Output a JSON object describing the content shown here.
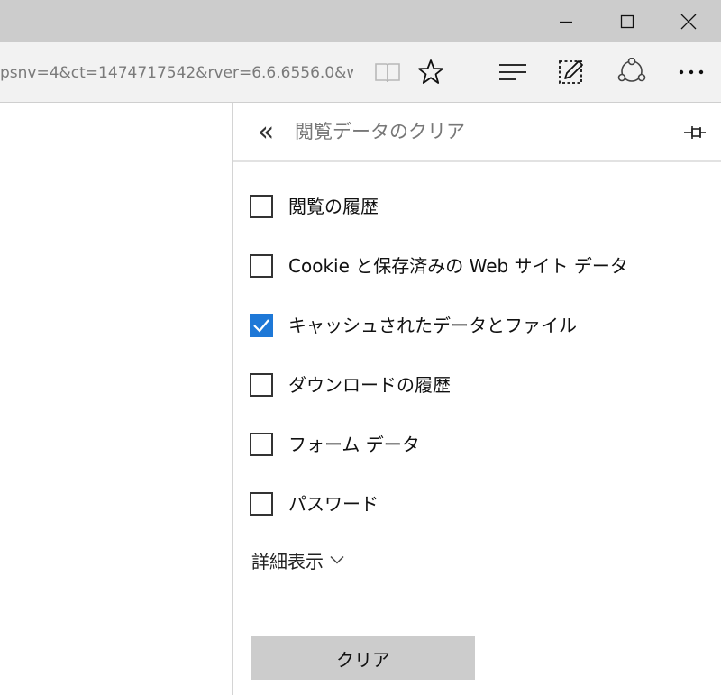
{
  "address_bar": {
    "url_text": "psnv=4&ct=1474717542&rver=6.6.6556.0&w"
  },
  "toolbar": {
    "icons": [
      "reading-view-icon",
      "favorite-star-icon",
      "hub-icon",
      "web-note-icon",
      "share-icon",
      "more-icon"
    ]
  },
  "window_controls": {
    "icons": [
      "minimize-icon",
      "maximize-icon",
      "close-icon"
    ]
  },
  "clear_panel": {
    "title": "閲覧データのクリア",
    "back_glyph": "«",
    "options": [
      {
        "label": "閲覧の履歴",
        "checked": false
      },
      {
        "label": "Cookie と保存済みの Web サイト データ",
        "checked": false
      },
      {
        "label": "キャッシュされたデータとファイル",
        "checked": true
      },
      {
        "label": "ダウンロードの履歴",
        "checked": false
      },
      {
        "label": "フォーム データ",
        "checked": false
      },
      {
        "label": "パスワード",
        "checked": false
      }
    ],
    "show_more_label": "詳細表示",
    "clear_button_label": "クリア",
    "accent_color": "#1e78d7"
  }
}
